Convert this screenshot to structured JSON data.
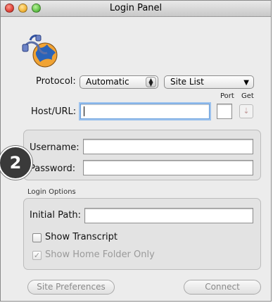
{
  "window": {
    "title": "Login Panel"
  },
  "protocol": {
    "label": "Protocol:",
    "value": "Automatic"
  },
  "site_list": {
    "value": "Site List"
  },
  "host": {
    "label": "Host/URL:",
    "value": ""
  },
  "port": {
    "label": "Port",
    "value": ""
  },
  "get": {
    "label": "Get"
  },
  "credentials": {
    "username_label": "Username:",
    "password_label": "Password:"
  },
  "badge": {
    "number": "2"
  },
  "login_options": {
    "title": "Login Options",
    "initial_path_label": "Initial Path:",
    "show_transcript_label": "Show Transcript",
    "show_home_folder_label": "Show Home Folder Only"
  },
  "buttons": {
    "site_preferences": "Site Preferences",
    "connect": "Connect"
  },
  "icons": {
    "app_logo": "globe-with-cable-icon",
    "get_arrow": "down-arrow-icon",
    "stepper": "up-down-stepper-icon",
    "dropdown": "triangle-down-icon"
  },
  "colors": {
    "focus_ring": "#9cc2ee",
    "badge_bg": "#3a3a3a"
  }
}
